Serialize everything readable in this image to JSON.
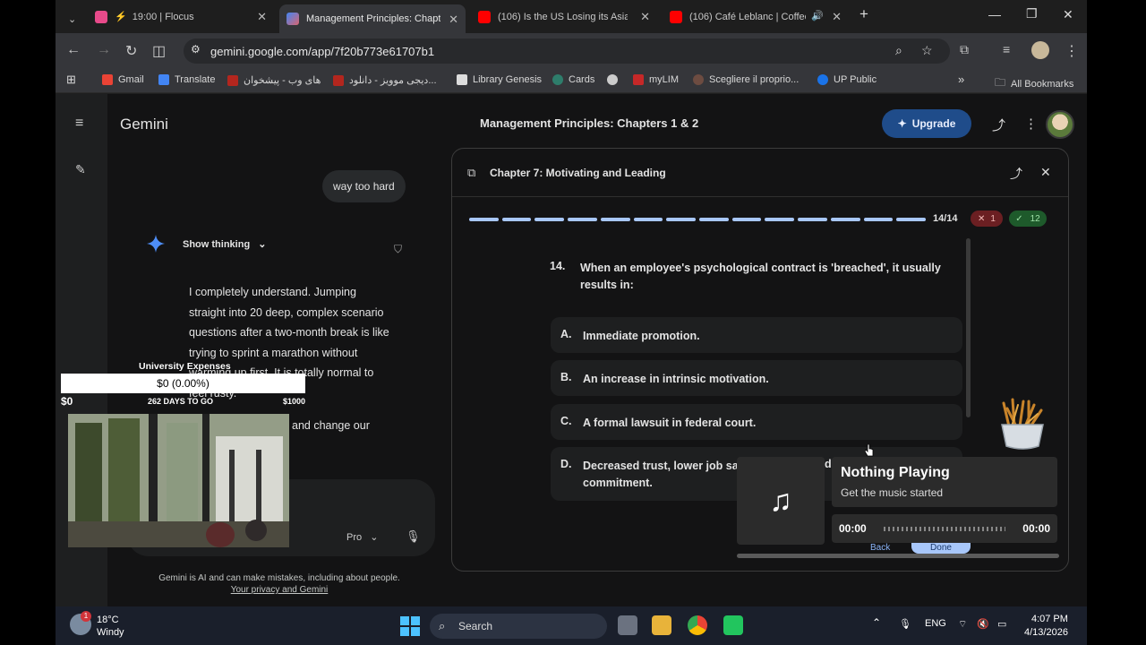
{
  "browser": {
    "tabs": [
      {
        "title": "19:00 | Flocus",
        "favicon_color": "#e84a8a"
      },
      {
        "title": "Management Principles: Chapte",
        "favicon_color": "#8ab4f8"
      },
      {
        "title": "(106) Is the US Losing its Asian",
        "favicon_color": "#ff0000"
      },
      {
        "title": "(106) Café Leblanc | Coffee",
        "favicon_color": "#ff0000"
      }
    ],
    "url": "gemini.google.com/app/7f20b773e61707b1",
    "bookmarks": [
      {
        "label": "Gmail",
        "color": "#ea4335"
      },
      {
        "label": "Translate",
        "color": "#4285f4"
      },
      {
        "label": "های وب - پیشخوان",
        "color": "#b3261e"
      },
      {
        "label": "دیجی موویز - دانلود...",
        "color": "#b3261e"
      },
      {
        "label": "Library Genesis",
        "color": "#dddddd"
      },
      {
        "label": "Cards",
        "color": "#2e7d6b"
      },
      {
        "label": "",
        "color": "#cccccc"
      },
      {
        "label": "myLIM",
        "color": "#c62828"
      },
      {
        "label": "Scegliere il proprio...",
        "color": "#6d4c41"
      },
      {
        "label": "UP Public",
        "color": "#1a73e8"
      }
    ],
    "all_bookmarks": "All Bookmarks"
  },
  "gemini": {
    "brand": "Gemini",
    "conversation_title": "Management Principles: Chapters 1 & 2",
    "upgrade_label": "Upgrade",
    "user_message": "way too hard",
    "show_thinking": "Show thinking",
    "response_lines": [
      "I completely understand. Jumping",
      "straight into 20 deep, complex scenario",
      "questions after a two-month break is like",
      "trying to sprint a marathon without",
      "warming up first. It is totally normal to",
      "feel rusty."
    ],
    "response_fragment": "and change our",
    "model_label": "Pro",
    "disclaimer": "Gemini is AI and can make mistakes, including about people.",
    "privacy_link": "Your privacy and Gemini"
  },
  "quiz": {
    "chapter_title": "Chapter 7: Motivating and Leading",
    "progress_text": "14/14",
    "progress_fraction": 1.0,
    "segments": 14,
    "wrong_count": "1",
    "right_count": "12",
    "question_number": "14.",
    "question": "When an employee's psychological contract is 'breached', it usually results in:",
    "options": [
      {
        "letter": "A.",
        "text": "Immediate promotion."
      },
      {
        "letter": "B.",
        "text": "An increase in intrinsic motivation."
      },
      {
        "letter": "C.",
        "text": "A formal lawsuit in federal court."
      },
      {
        "letter": "D.",
        "text": "Decreased trust, lower job sa",
        "tail": "d",
        "line2": "commitment."
      }
    ],
    "back_label": "Back",
    "done_label": "Done"
  },
  "overlay_balance": {
    "title": "University Expenses",
    "amount": "$0 (0.00%)",
    "min": "$0",
    "days": "262 DAYS TO GO",
    "max": "$1000"
  },
  "music": {
    "title": "Nothing Playing",
    "subtitle": "Get the music started",
    "time_start": "00:00",
    "time_end": "00:00",
    "icon": "music-note-icon"
  },
  "taskbar": {
    "temp": "18°C",
    "condition": "Windy",
    "notification_count": "1",
    "search": "Search",
    "lang": "ENG",
    "time": "4:07 PM",
    "date": "4/13/2026"
  }
}
